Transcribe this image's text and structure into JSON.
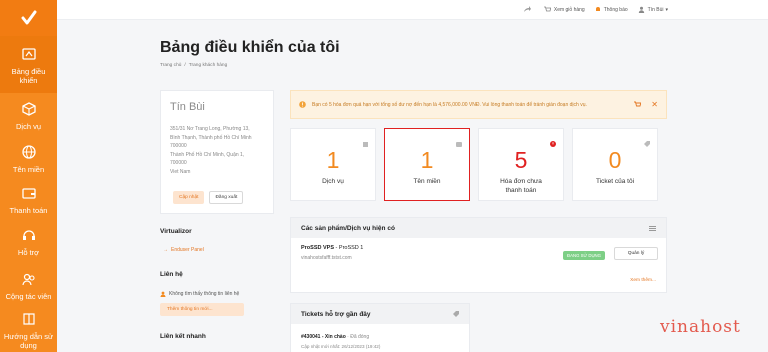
{
  "sidebar": {
    "items": [
      {
        "label": "Bảng điều khiển",
        "icon": "dashboard-icon"
      },
      {
        "label": "Dịch vụ",
        "icon": "box-icon"
      },
      {
        "label": "Tên miền",
        "icon": "globe-icon"
      },
      {
        "label": "Thanh toán",
        "icon": "wallet-icon"
      },
      {
        "label": "Hỗ trợ",
        "icon": "support-icon"
      },
      {
        "label": "Cộng tác viên",
        "icon": "partner-icon"
      },
      {
        "label": "Hướng dẫn sử dụng",
        "icon": "guide-icon"
      }
    ]
  },
  "topbar": {
    "cart": "Xem giỏ hàng",
    "notifications": "Thông báo",
    "user": "Tín Bùi"
  },
  "page": {
    "title": "Bảng điều khiển của tôi",
    "breadcrumb": [
      "Trang chủ",
      "/",
      "Trang khách hàng"
    ]
  },
  "profile": {
    "name": "Tín Bùi",
    "address_lines": [
      "351/31 Nơ Trang Long, Phường 13,",
      "Bình Thạnh, Thành phố Hồ Chí Minh",
      "700000",
      "Thành Phố Hồ Chí Minh, Quận 1,",
      "700000",
      "Viet Nam"
    ],
    "update_button": "Cập nhật",
    "logout_button": "Đăng xuất"
  },
  "virtualizor": {
    "title": "Virtualizor",
    "link": "Enduser Panel"
  },
  "contact": {
    "title": "Liên hệ",
    "empty_text": "Không tìm thấy thông tin liên hệ",
    "add_button": "Thêm thông tin mới..."
  },
  "quick_links": {
    "title": "Liên kết nhanh"
  },
  "alert": {
    "message": "Bạn có 5 hóa đơn quá hạn với tổng số dư nợ đến hạn là 4,576,000.00 VNĐ. Vui lòng thanh toán để tránh gián đoạn dịch vụ."
  },
  "stats": [
    {
      "value": "1",
      "label": "Dịch vụ"
    },
    {
      "value": "1",
      "label": "Tên miền"
    },
    {
      "value": "5",
      "label": "Hóa đơn chưa thanh toán"
    },
    {
      "value": "0",
      "label": "Ticket của tôi"
    }
  ],
  "services": {
    "title": "Các sản phẩm/Dịch vụ hiện có",
    "item_name": "ProSSD VPS",
    "item_plan": " - ProSSD 1",
    "item_domain": "vinahostsfafff.tstst.com",
    "status": "ĐANG SỬ DỤNG",
    "manage_button": "Quản lý",
    "view_more": "Xem thêm..."
  },
  "tickets": {
    "title": "Tickets hỗ trợ gần đây",
    "ticket_id": "#430041 - Xin chào",
    "ticket_status": "Đã đóng",
    "ticket_updated": "Cập nhật mới nhất: 26/12/2023 (19:42)"
  },
  "watermark": "vinahost",
  "colors": {
    "accent": "#f58a1f",
    "danger": "#e02121",
    "success": "#7dcf86"
  }
}
